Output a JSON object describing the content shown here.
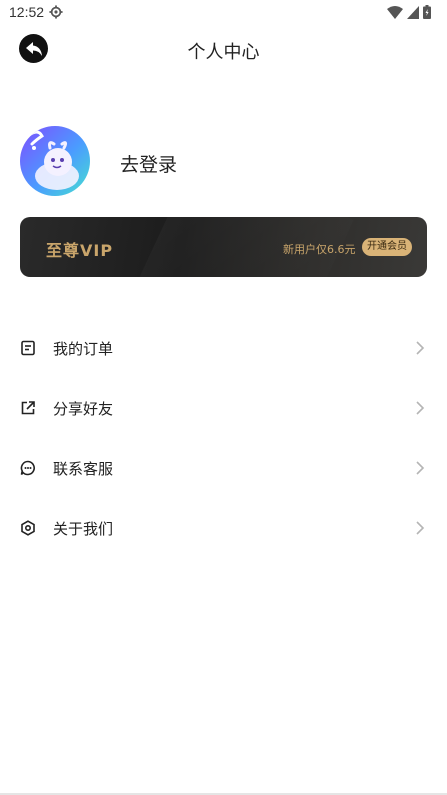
{
  "status_bar": {
    "time": "12:52",
    "icons": [
      "gear-icon",
      "wifi-icon",
      "cell-signal-icon",
      "battery-icon"
    ]
  },
  "header": {
    "title": "个人中心",
    "back_icon": "back-arrow-icon"
  },
  "profile": {
    "login_label": "去登录"
  },
  "vip": {
    "title": "至尊VIP",
    "price_text": "新用户仅6.6元",
    "button_label": "开通会员",
    "accent_color": "#c9a56b"
  },
  "menu": {
    "items": [
      {
        "label": "我的订单",
        "icon": "order-list-icon"
      },
      {
        "label": "分享好友",
        "icon": "share-icon"
      },
      {
        "label": "联系客服",
        "icon": "chat-icon"
      },
      {
        "label": "关于我们",
        "icon": "about-icon"
      }
    ]
  }
}
